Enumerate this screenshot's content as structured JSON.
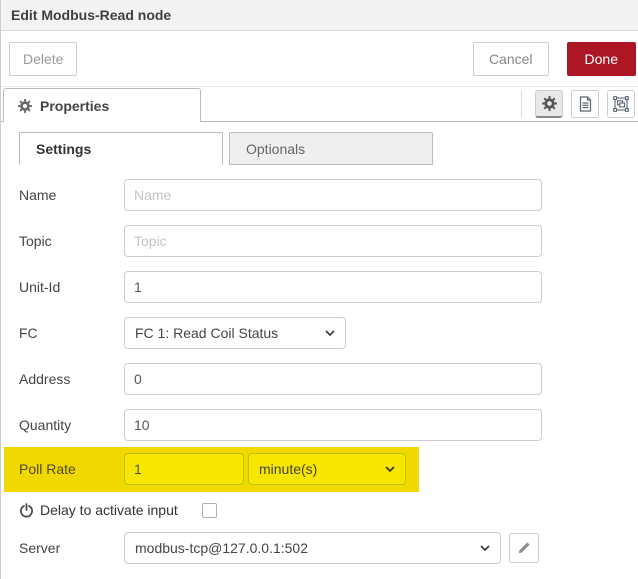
{
  "dialog": {
    "title": "Edit Modbus-Read node"
  },
  "buttons": {
    "delete": "Delete",
    "cancel": "Cancel",
    "done": "Done"
  },
  "tray_tabs": {
    "properties": "Properties"
  },
  "subtabs": {
    "settings": "Settings",
    "optionals": "Optionals"
  },
  "form": {
    "name": {
      "label": "Name",
      "placeholder": "Name"
    },
    "topic": {
      "label": "Topic",
      "placeholder": "Topic"
    },
    "unit_id": {
      "label": "Unit-Id",
      "value": "1"
    },
    "fc": {
      "label": "FC",
      "value": "FC 1: Read Coil Status"
    },
    "address": {
      "label": "Address",
      "value": "0"
    },
    "quantity": {
      "label": "Quantity",
      "value": "10"
    },
    "poll_rate": {
      "label": "Poll Rate",
      "value": "1",
      "unit": "minute(s)"
    },
    "delay": {
      "label": "Delay to activate input",
      "checked": false
    },
    "server": {
      "label": "Server",
      "value": "modbus-tcp@127.0.0.1:502"
    }
  },
  "colors": {
    "done_bg": "#ad1625",
    "done_text": "#ffffff",
    "highlight_band": "#f0d800",
    "highlight_field": "#f7e600"
  }
}
